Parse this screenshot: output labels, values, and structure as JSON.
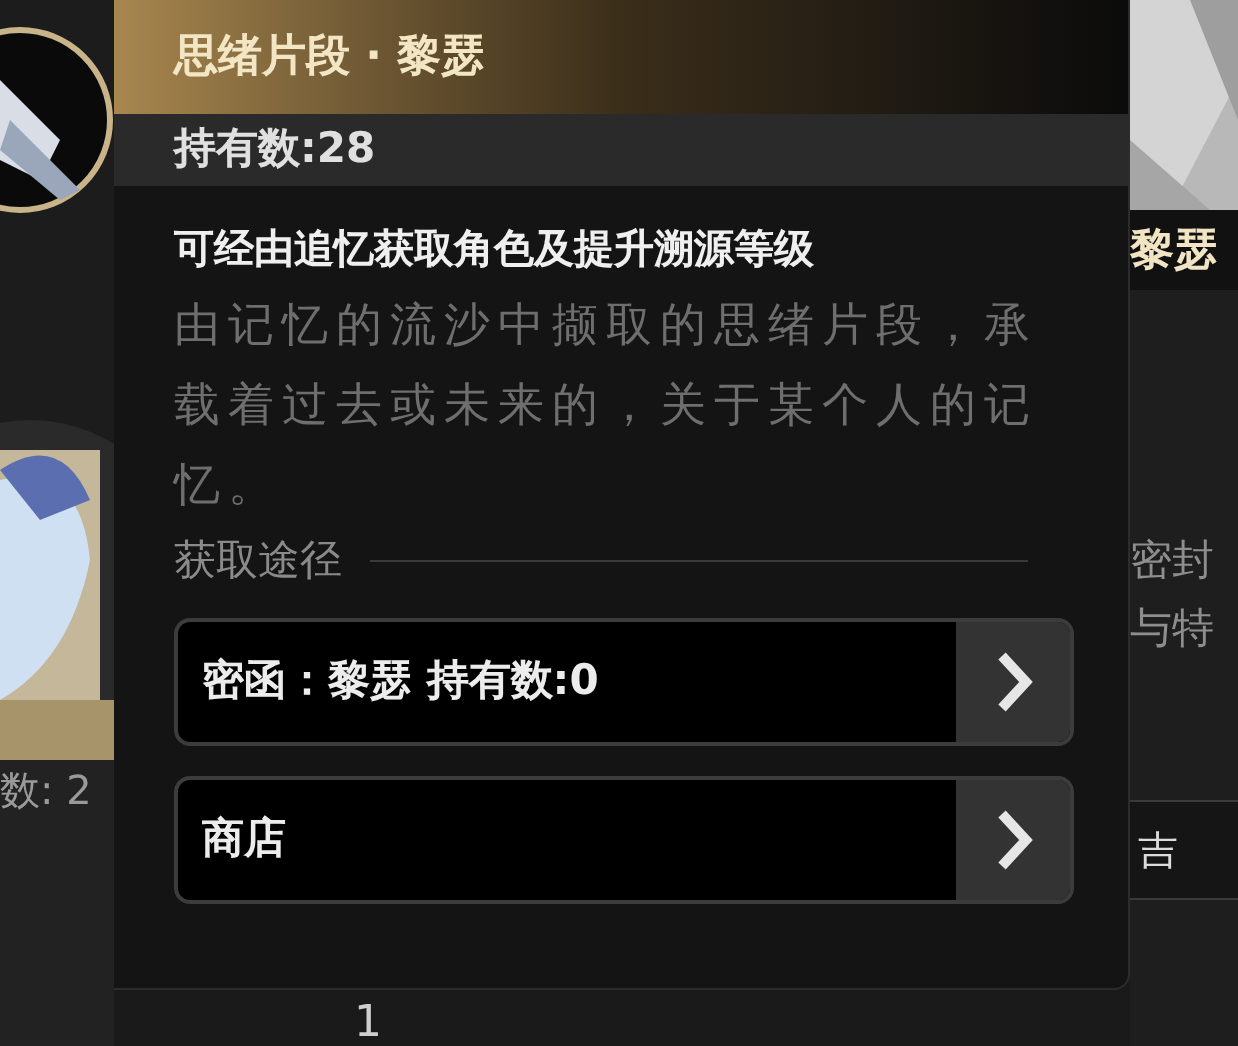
{
  "background": {
    "left": {
      "count_fragment": "数: 2"
    },
    "right": {
      "name": "黎瑟",
      "text_lines": [
        "密封",
        "与特"
      ],
      "button_fragment": "吉"
    },
    "bottom_number": "1"
  },
  "popup": {
    "title": "思绪片段 · 黎瑟",
    "owned": "持有数:28",
    "subtitle": "可经由追忆获取角色及提升溯源等级",
    "description": "由记忆的流沙中撷取的思绪片段，承载着过去或未来的，关于某个人的记忆。",
    "sources_heading": "获取途径",
    "sources": [
      {
        "label": "密函：黎瑟 持有数:0"
      },
      {
        "label": "商店"
      }
    ]
  }
}
